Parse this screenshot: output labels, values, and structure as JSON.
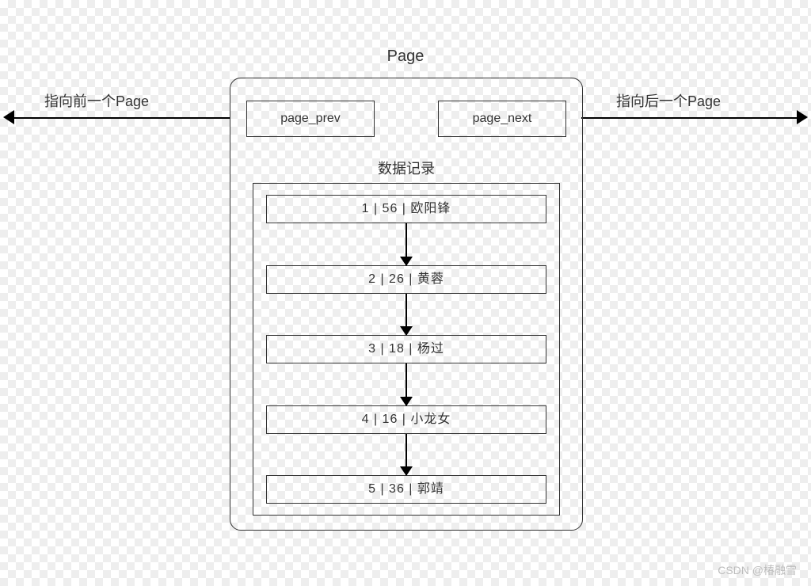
{
  "title": "Page",
  "pointers": {
    "prev": {
      "box_label": "page_prev",
      "caption": "指向前一个Page"
    },
    "next": {
      "box_label": "page_next",
      "caption": "指向后一个Page"
    }
  },
  "records": {
    "title": "数据记录",
    "separator": " | ",
    "rows": [
      {
        "id": 1,
        "age": 56,
        "name": "欧阳锋"
      },
      {
        "id": 2,
        "age": 26,
        "name": "黄蓉"
      },
      {
        "id": 3,
        "age": 18,
        "name": "杨过"
      },
      {
        "id": 4,
        "age": 16,
        "name": "小龙女"
      },
      {
        "id": 5,
        "age": 36,
        "name": "郭靖"
      }
    ]
  },
  "watermark": "CSDN @椿融雪"
}
